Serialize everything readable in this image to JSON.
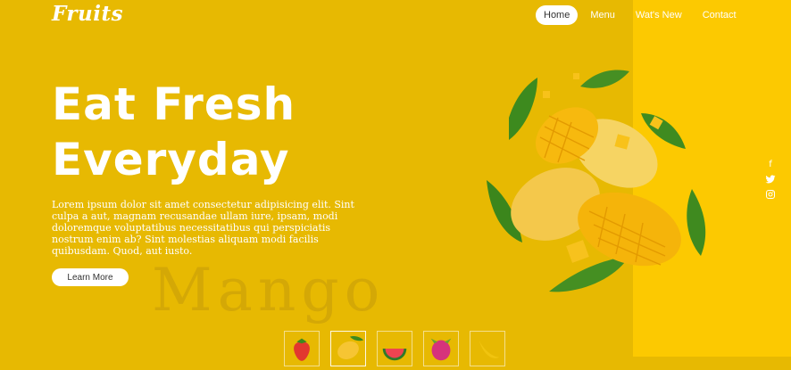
{
  "brand": {
    "logo": "Fruits"
  },
  "nav": {
    "items": [
      {
        "label": "Home",
        "active": true
      },
      {
        "label": "Menu"
      },
      {
        "label": "Wat's New"
      },
      {
        "label": "Contact"
      }
    ]
  },
  "hero": {
    "title_line1": "Eat Fresh",
    "title_line2": "Everyday",
    "text": "Lorem ipsum dolor sit amet consectetur adipisicing elit. Sint culpa a aut, magnam recusandae ullam iure, ipsam, modi doloremque voluptatibus necessitatibus qui perspiciatis nostrum enim ab? Sint molestias aliquam modi facilis quibusdam. Quod, aut iusto.",
    "button": "Learn More",
    "watermark": "Mango"
  },
  "social": {
    "icons": [
      "facebook-icon",
      "twitter-icon",
      "instagram-icon"
    ]
  },
  "thumbnails": [
    {
      "fruit": "strawberry"
    },
    {
      "fruit": "mango",
      "active": true
    },
    {
      "fruit": "watermelon"
    },
    {
      "fruit": "dragon-fruit"
    },
    {
      "fruit": "banana"
    }
  ],
  "colors": {
    "background": "#e7b902",
    "panel": "#fcc901",
    "accent": "#ffffff"
  }
}
